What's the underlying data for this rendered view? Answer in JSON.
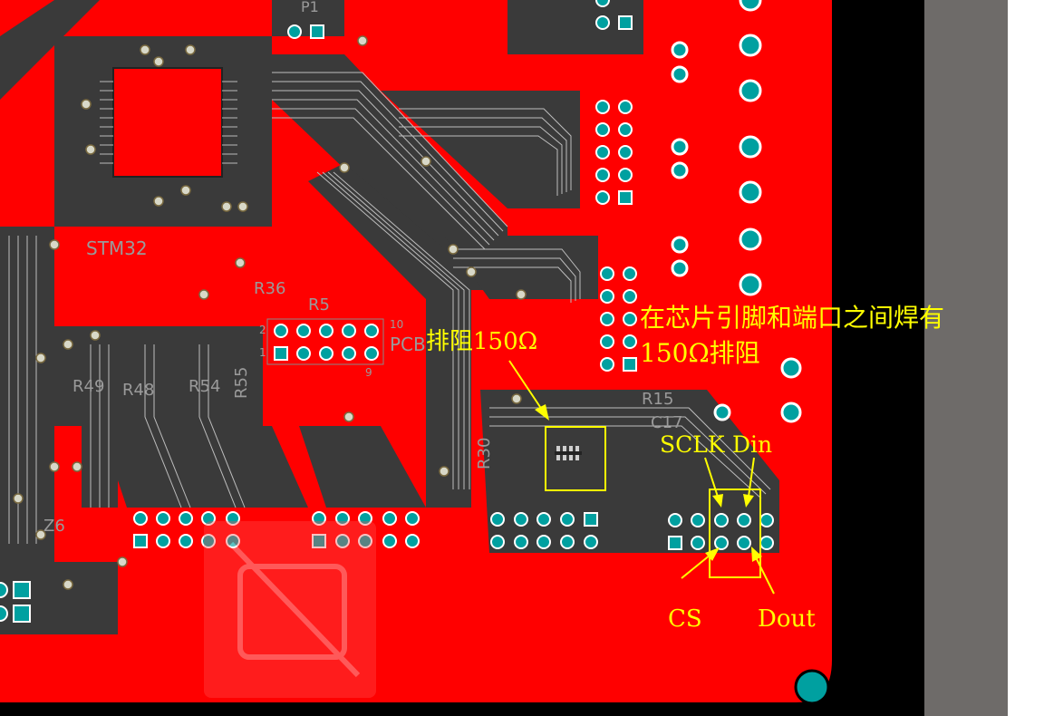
{
  "colors": {
    "board_red": "#ff0000",
    "board_dark": "#3a3a3a",
    "outer_frame": "#000000",
    "side_panel": "#6e6b69",
    "annotation": "#ffff00",
    "pad_ring": "#00a0a0",
    "silkscreen": "#9a9a9a"
  },
  "annotations": {
    "pin_resistor": "在芯片引脚和端口之间焊有",
    "pin_resistor_line2": "150Ω排阻",
    "array_resistor": "排阻150Ω",
    "sclk": "SCLK",
    "din": "Din",
    "cs": "CS",
    "dout": "Dout"
  },
  "silkscreen": {
    "chip": "STM32",
    "r36": "R36",
    "r5": "R5",
    "pcb": "PCB",
    "r49": "R49",
    "r48": "R48",
    "r54": "R54",
    "r55": "R55",
    "r30": "R30",
    "r15": "R15",
    "c17": "C17",
    "z6": "Z6",
    "p1": "P1",
    "pin2": "2",
    "pin1": "1",
    "pin10": "10",
    "pin9": "9"
  }
}
